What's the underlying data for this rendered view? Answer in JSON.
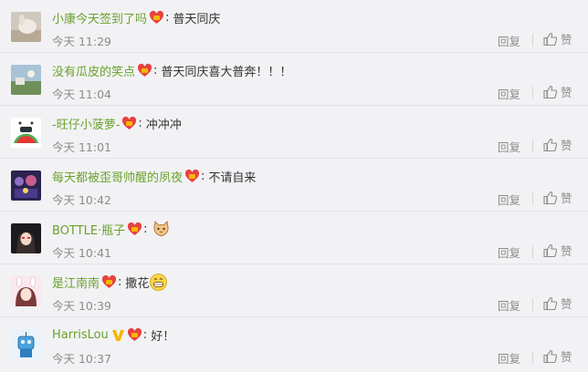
{
  "comments": [
    {
      "user": "小康今天签到了吗",
      "text": "普天同庆",
      "time": "今天 11:29",
      "reply_label": "回复",
      "like_label": "赞",
      "avatar_icon": "avatar-rabbit-photo"
    },
    {
      "user": "没有瓜皮的笑点",
      "text": "普天同庆喜大普奔！！！",
      "time": "今天 11:04",
      "reply_label": "回复",
      "like_label": "赞",
      "avatar_icon": "avatar-landscape-photo"
    },
    {
      "user": "-旺仔小菠萝-",
      "text": "冲冲冲",
      "time": "今天 11:01",
      "reply_label": "回复",
      "like_label": "赞",
      "avatar_icon": "avatar-cartoon-watermelon"
    },
    {
      "user": "每天都被歪哥帅醒的夙夜",
      "text": "不请自来",
      "time": "今天 10:42",
      "reply_label": "回复",
      "like_label": "赞",
      "avatar_icon": "avatar-group-illustration"
    },
    {
      "user": "BOTTLE·瓶子",
      "text": "",
      "time": "今天 10:41",
      "reply_label": "回复",
      "like_label": "赞",
      "avatar_icon": "avatar-anime-character",
      "emoji": "cat-face-emoji"
    },
    {
      "user": "是江南南",
      "text": "撒花",
      "time": "今天 10:39",
      "reply_label": "回复",
      "like_label": "赞",
      "avatar_icon": "avatar-anime-girl",
      "emoji": "grin-emoji"
    },
    {
      "user": "HarrisLou",
      "text": "好！",
      "time": "今天 10:37",
      "reply_label": "回复",
      "like_label": "赞",
      "avatar_icon": "avatar-cartoon-robot",
      "verified": true
    }
  ],
  "colors": {
    "username": "#6aa22c",
    "meta_text": "#8c8c8c",
    "background": "#f2f2f5",
    "badge_red": "#e8423f",
    "badge_gold": "#f5b800",
    "verified_gold": "#f7b500"
  }
}
